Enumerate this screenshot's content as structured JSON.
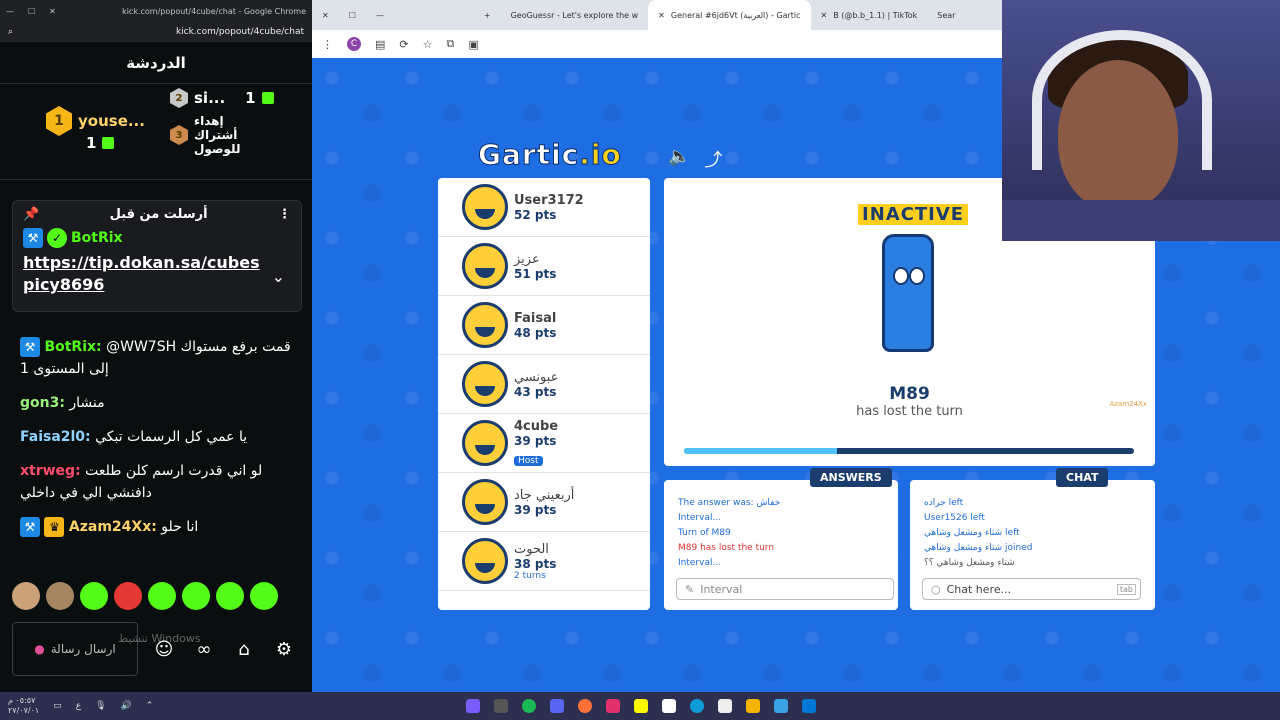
{
  "kick": {
    "window_title": "kick.com/popout/4cube/chat - Google Chrome",
    "url": "kick.com/popout/4cube/chat",
    "header": "الدردشة",
    "leaderboard": [
      {
        "rank": "1",
        "name": "youse...",
        "count": "1"
      },
      {
        "rank": "2",
        "name": "si...",
        "count": "1"
      },
      {
        "rank": "3",
        "name": "إهداء أشتراك للوصول",
        "count": ""
      }
    ],
    "pinned": {
      "title": "أرسلت من قبل",
      "user": "BotRix",
      "link_line1": "https://tip.dokan.sa/cubes",
      "link_line2": "picy8696"
    },
    "messages": [
      {
        "user": "BotRix:",
        "text": "@WW7SH قمت برفع مستواك إلى المستوى 1",
        "color": "#53fc18"
      },
      {
        "user": "gon3:",
        "text": "منشار",
        "color": "#9bf27b"
      },
      {
        "user": "Faisa2l0:",
        "text": "يا عمي كل الرسمات تبكي",
        "color": "#8fd3ff"
      },
      {
        "user": "xtrweg:",
        "text": "لو اني قدرت ارسم كلن طلعت دافنشي الي في داخلي",
        "color": "#ff4d6d"
      },
      {
        "user": "Azam24Xx:",
        "text": "انا حلو",
        "color": "#ffd36b"
      }
    ],
    "send_placeholder": "ارسال رسالة",
    "watermark": "تنشيط Windows"
  },
  "browser": {
    "tabs": [
      {
        "label": "GeoGuessr - Let's explore the w",
        "active": false
      },
      {
        "label": "General #6jd6Vt (العربية) - Gartic",
        "active": true
      },
      {
        "label": "B (@b.b_1.1) | TikTok",
        "active": false
      },
      {
        "label": "Sear",
        "active": false
      }
    ]
  },
  "game": {
    "logo_main": "Gartic",
    "logo_suffix": ".io",
    "players": [
      {
        "name": "User3172",
        "pts": "52 pts",
        "extra": ""
      },
      {
        "name": "عزيز",
        "pts": "51 pts",
        "extra": ""
      },
      {
        "name": "Faisal",
        "pts": "48 pts",
        "extra": ""
      },
      {
        "name": "عبونسي",
        "pts": "43 pts",
        "extra": ""
      },
      {
        "name": "4cube",
        "pts": "39 pts",
        "extra": "Host"
      },
      {
        "name": "أربعيني جاد",
        "pts": "39 pts",
        "extra": ""
      },
      {
        "name": "الحوت",
        "pts": "38 pts",
        "extra": "2 turns"
      }
    ],
    "stage": {
      "status": "INACTIVE",
      "player": "M89",
      "message": "has lost the turn",
      "progress": 0.34,
      "drawer_tag": "Azam24Xx"
    },
    "answers": {
      "tab": "ANSWERS",
      "lines": [
        {
          "text": "The answer was: خفاش",
          "red": false
        },
        {
          "text": "Interval...",
          "red": false
        },
        {
          "text": "Turn of M89",
          "red": false
        },
        {
          "text": "M89 has lost the turn",
          "red": true
        },
        {
          "text": "Interval...",
          "red": false
        }
      ],
      "input_placeholder": "Interval"
    },
    "chat": {
      "tab": "CHAT",
      "lines": [
        {
          "text": "جراده left"
        },
        {
          "text": "User1526 left"
        },
        {
          "text": "شتاء ومشعل وشاهي left"
        },
        {
          "text": "شتاء ومشعل وشاهي joined"
        },
        {
          "text": "شتاء ومشعل وشاهي ؟؟"
        }
      ],
      "input_placeholder": "Chat here...",
      "input_hint": "tab"
    }
  },
  "taskbar": {
    "date": "٢٧/٠٧/٠١",
    "time": "٠٥:٥٧ م"
  }
}
